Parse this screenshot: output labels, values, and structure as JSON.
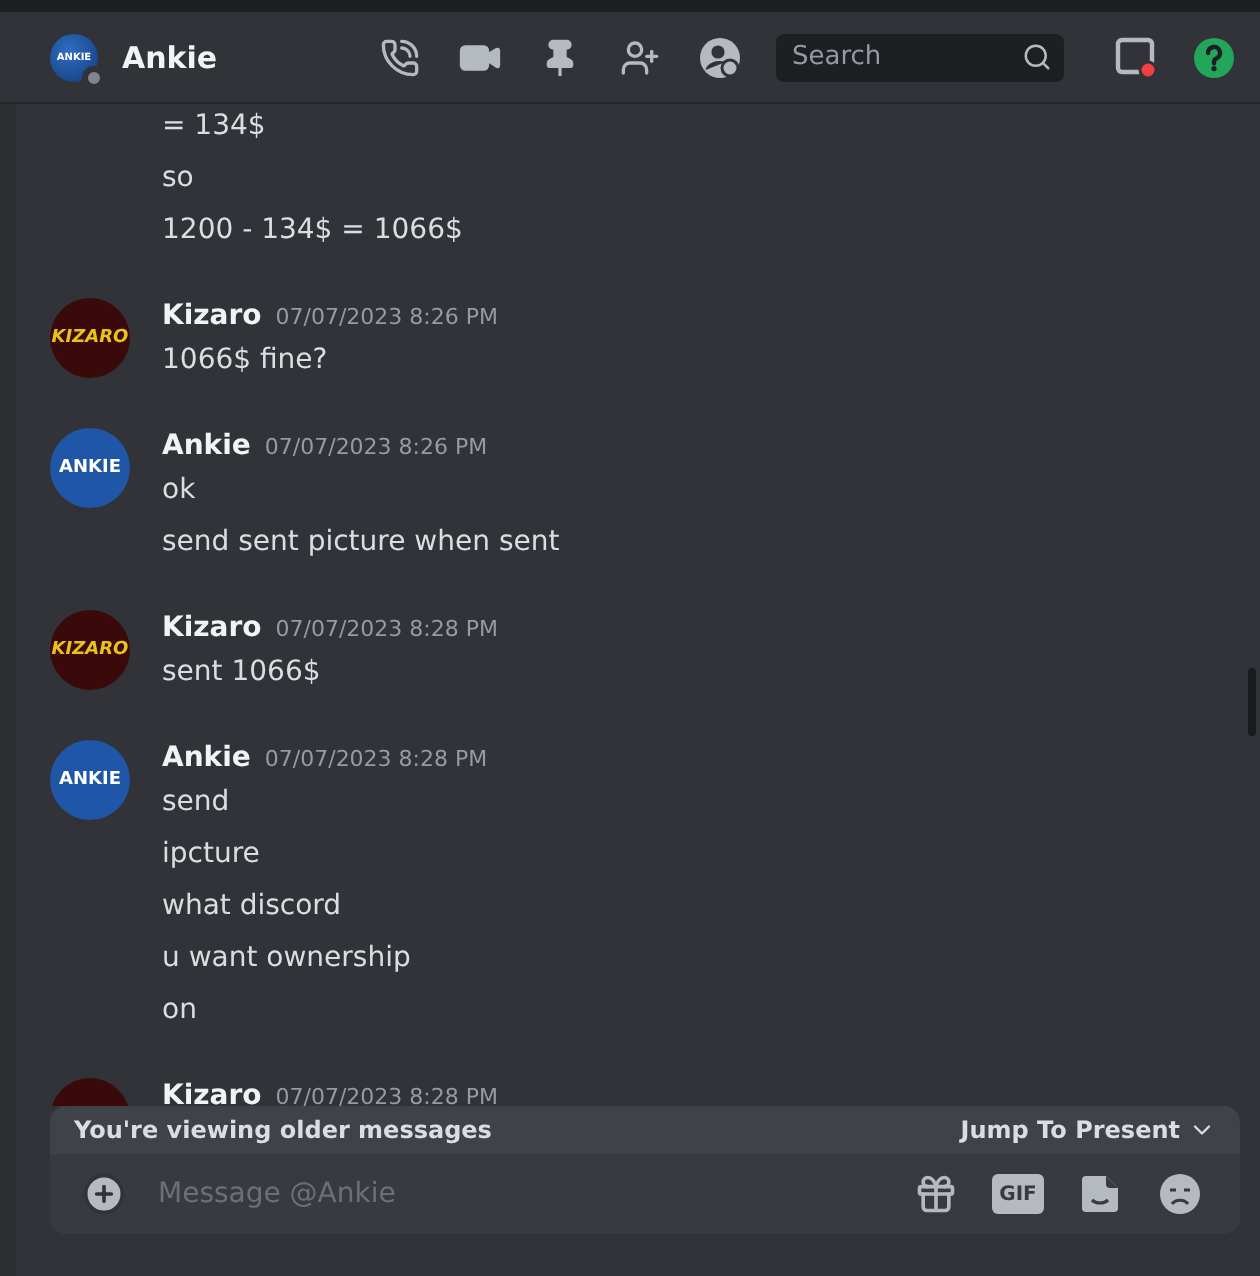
{
  "header": {
    "avatar_label": "ANKIE",
    "online": false,
    "name": "Ankie",
    "search": {
      "placeholder": "Search"
    },
    "inbox_unread": true
  },
  "messages": [
    {
      "lines": [
        "= 134$",
        "so",
        "1200 - 134$ = 1066$"
      ]
    },
    {
      "author": "Kizaro",
      "kind": "italic",
      "color": "#3a0a0a",
      "avatar_label": "KIZARO",
      "timestamp": "07/07/2023 8:26 PM",
      "lines": [
        "1066$ fine?"
      ]
    },
    {
      "author": "Ankie",
      "kind": "plain",
      "color": "#1f56a8",
      "avatar_label": "ANKIE",
      "timestamp": "07/07/2023 8:26 PM",
      "lines": [
        "ok",
        "send sent picture when sent"
      ]
    },
    {
      "author": "Kizaro",
      "kind": "italic",
      "color": "#3a0a0a",
      "avatar_label": "KIZARO",
      "timestamp": "07/07/2023 8:28 PM",
      "lines": [
        "sent 1066$"
      ]
    },
    {
      "author": "Ankie",
      "kind": "plain",
      "color": "#1f56a8",
      "avatar_label": "ANKIE",
      "timestamp": "07/07/2023 8:28 PM",
      "lines": [
        "send",
        "ipcture",
        "what discord",
        "u want ownership",
        "on"
      ]
    },
    {
      "author": "Kizaro",
      "kind": "italic",
      "color": "#3a0a0a",
      "timestamp": "07/07/2023 8:28 PM"
    }
  ],
  "banner": {
    "text": "You're viewing older messages",
    "action": "Jump To Present"
  },
  "composer": {
    "placeholder": "Message @Ankie",
    "gif_label": "GIF"
  }
}
